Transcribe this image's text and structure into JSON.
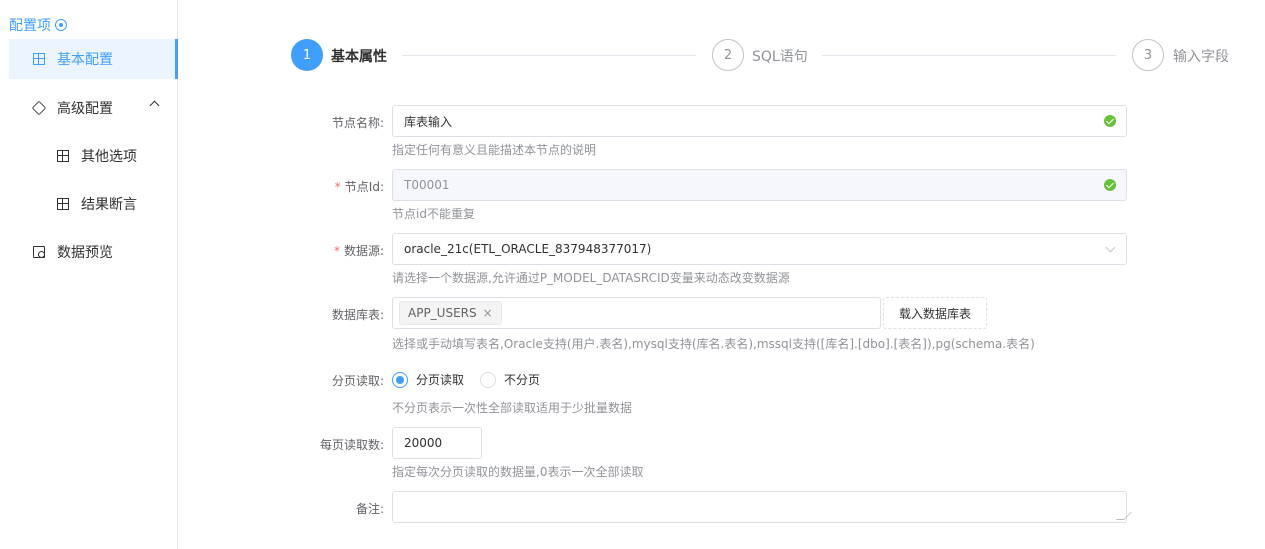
{
  "sidebar": {
    "header": "配置项",
    "items": [
      {
        "label": "基本配置"
      },
      {
        "label": "高级配置"
      },
      {
        "label": "其他选项"
      },
      {
        "label": "结果断言"
      },
      {
        "label": "数据预览"
      }
    ]
  },
  "steps": [
    {
      "number": "1",
      "label": "基本属性"
    },
    {
      "number": "2",
      "label": "SQL语句"
    },
    {
      "number": "3",
      "label": "输入字段"
    }
  ],
  "form": {
    "node_name": {
      "label": "节点名称:",
      "value": "库表输入",
      "hint": "指定任何有意义且能描述本节点的说明"
    },
    "node_id": {
      "required_mark": "*",
      "label": "节点Id:",
      "value": "T00001",
      "hint": "节点id不能重复"
    },
    "datasource": {
      "required_mark": "*",
      "label": "数据源:",
      "value": "oracle_21c(ETL_ORACLE_837948377017)",
      "hint": "请选择一个数据源,允许通过P_MODEL_DATASRCID变量来动态改变数据源"
    },
    "db_table": {
      "label": "数据库表:",
      "tag": "APP_USERS",
      "tag_close": "×",
      "load_button": "载入数据库表",
      "hint": "选择或手动填写表名,Oracle支持(用户.表名),mysql支持(库名.表名),mssql支持([库名].[dbo].[表名]),pg(schema.表名)"
    },
    "paging": {
      "label": "分页读取:",
      "options": [
        "分页读取",
        "不分页"
      ],
      "selected": "分页读取",
      "hint": "不分页表示一次性全部读取适用于少批量数据"
    },
    "page_size": {
      "label": "每页读取数:",
      "value": "20000",
      "hint": "指定每次分页读取的数据量,0表示一次全部读取"
    },
    "remark": {
      "label": "备注:",
      "value": ""
    }
  },
  "colors": {
    "primary": "#409eff",
    "success": "#67c23a",
    "danger": "#f56c6c"
  }
}
